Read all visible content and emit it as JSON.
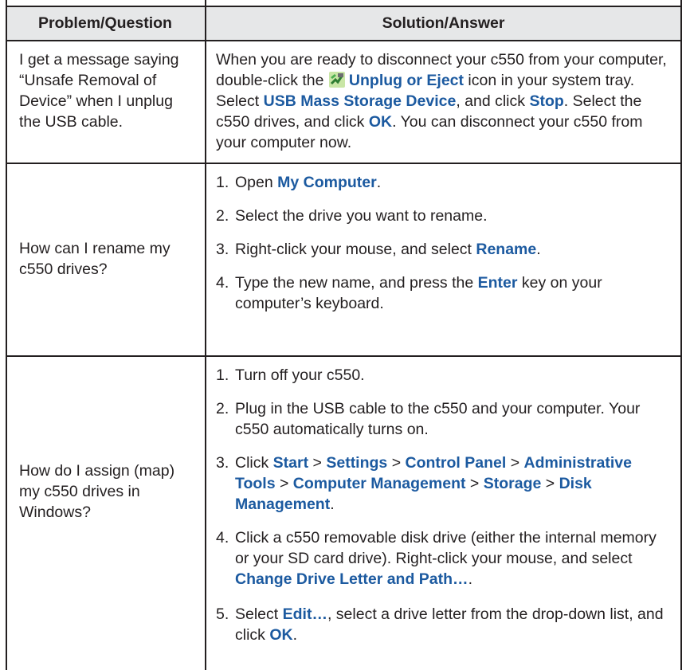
{
  "headers": {
    "problem": "Problem/Question",
    "solution": "Solution/Answer"
  },
  "rows": [
    {
      "question": "I get a message saying “Unsafe Removal of Device” when I unplug the USB cable.",
      "answer": {
        "t1": "When you are ready to disconnect your c550 from your computer, double-click the ",
        "b1": "Unplug or Eject",
        "t2": " icon in your system tray. Select ",
        "b2": "USB Mass Storage Device",
        "t3": ", and click ",
        "b3": "Stop",
        "t4": ". Select the c550 drives, and click ",
        "b4": "OK",
        "t5": ". You can disconnect your c550 from your computer now.",
        "icon": "unplug-eject-icon"
      }
    },
    {
      "question": "How can I rename my c550 drives?",
      "steps": [
        {
          "num": "1.",
          "t1": "Open ",
          "b1": "My Computer",
          "t2": "."
        },
        {
          "num": "2.",
          "t1": "Select the drive you want to rename."
        },
        {
          "num": "3.",
          "t1": "Right-click your mouse, and select ",
          "b1": "Rename",
          "t2": "."
        },
        {
          "num": "4.",
          "t1": "Type the new name, and press the ",
          "b1": "Enter",
          "t2": " key on your computer’s keyboard."
        }
      ]
    },
    {
      "question": "How do I assign (map) my c550 drives in Windows?",
      "steps": [
        {
          "num": "1.",
          "t1": "Turn off your c550."
        },
        {
          "num": "2.",
          "t1": "Plug in the USB cable to the c550 and your computer. Your c550 automatically turns on."
        },
        {
          "num": "3.",
          "t1": "Click ",
          "b1": "Start",
          "s1": " > ",
          "b2": "Settings",
          "s2": " > ",
          "b3": "Control Panel",
          "s3": " > ",
          "b4": "Administrative Tools",
          "s4": " > ",
          "b5": "Computer Management",
          "s5": " > ",
          "b6": "Storage",
          "s6": " > ",
          "b7": "Disk Management",
          "t2": "."
        },
        {
          "num": "4.",
          "t1": "Click a c550 removable disk drive (either the internal memory or your SD card drive). Right-click your mouse, and select ",
          "b1": "Change Drive Letter and Path…",
          "t2": "."
        },
        {
          "num": "5.",
          "t1": "Select ",
          "b1": "Edit…",
          "t2": ", select a drive letter from the drop-down list, and click ",
          "b2": "OK",
          "t3": "."
        }
      ]
    }
  ]
}
